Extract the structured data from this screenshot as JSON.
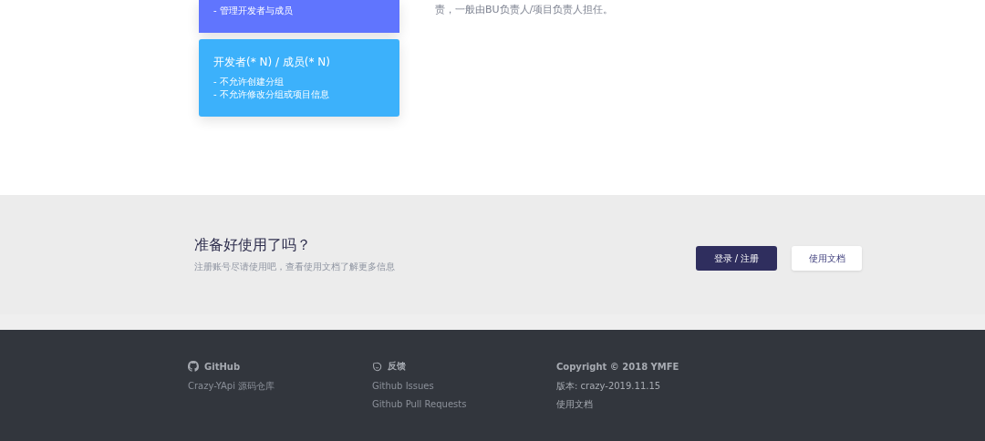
{
  "role_cards": [
    {
      "lines": [
        "- 管理开发者与成员"
      ],
      "color": "#6075fe"
    },
    {
      "title": "开发者(* N) / 成员(* N)",
      "lines": [
        "- 不允许创建分组",
        "- 不允许修改分组或项目信息"
      ],
      "color": "#3cb1fb"
    }
  ],
  "role_description": "责，一般由BU负责人/项目负责人担任。",
  "cta": {
    "heading": "准备好使用了吗？",
    "subtitle": "注册账号尽请使用吧，查看使用文档了解更多信息",
    "buttons": [
      {
        "label": "登录 / 注册",
        "kind": "primary"
      },
      {
        "label": "使用文档",
        "kind": "secondary"
      }
    ]
  },
  "footer": {
    "columns": [
      {
        "title": "GitHub",
        "links": [
          "Crazy-YApi 源码仓库"
        ]
      },
      {
        "title": "反馈",
        "links": [
          "Github Issues",
          "Github Pull Requests"
        ]
      },
      {
        "title": "Copyright © 2018 YMFE",
        "links": [
          "版本: crazy-2019.11.15",
          "使用文档"
        ]
      }
    ]
  }
}
